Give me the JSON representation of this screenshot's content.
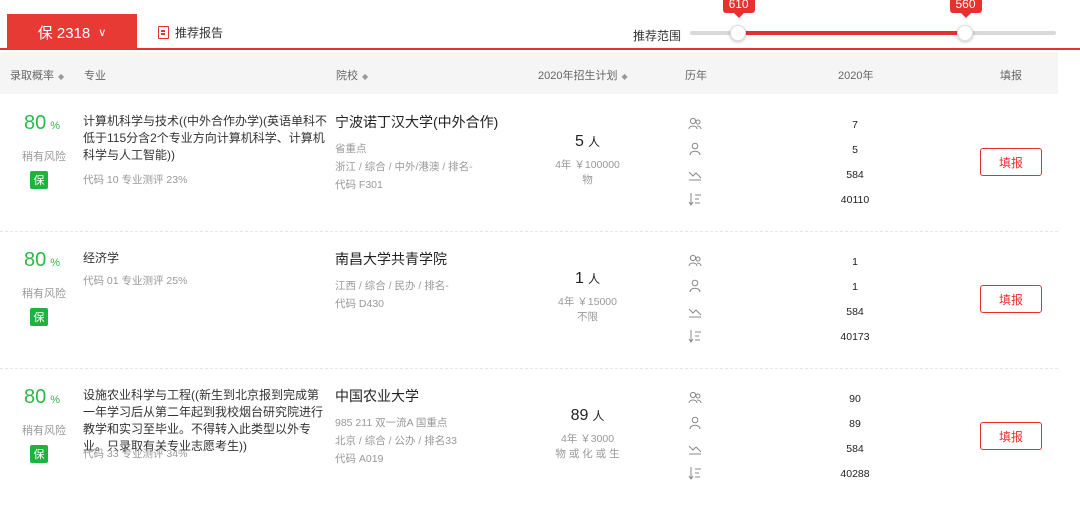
{
  "toolbar": {
    "bao_label": "保 2318",
    "report_label": "推荐报告",
    "range_label": "推荐范围",
    "range_low": "610",
    "range_high": "560",
    "range_low_fraction": 0.13,
    "range_high_fraction": 0.75
  },
  "header": {
    "prob": "录取概率",
    "major": "专业",
    "school": "院校",
    "plan": "2020年招生计划",
    "history": "历年",
    "year": "2020年",
    "fill": "填报"
  },
  "colors": {
    "accent": "#e8302f",
    "safe": "#2db84a"
  },
  "rows": [
    {
      "pct": "80",
      "pct_sym": "%",
      "risk": "稍有风险",
      "badge": "保",
      "major": "计算机科学与技术((中外合作办学)(英语单科不低于115分含2个专业方向计算机科学、计算机科学与人工智能))",
      "major_code": "代码 10   专业测评 23%",
      "school": "宁波诺丁汉大学(中外合作)",
      "school_tags": "省重点",
      "school_info": "浙江 / 综合 / 中外/港澳 / 排名-",
      "school_code": "代码 F301",
      "plan_num": "5",
      "plan_unit": "人",
      "plan_fee": "4年  ￥100000",
      "plan_note": "物",
      "hist": [
        "7",
        "5",
        "584",
        "40110"
      ],
      "fill_label": "填报"
    },
    {
      "pct": "80",
      "pct_sym": "%",
      "risk": "稍有风险",
      "badge": "保",
      "major": "经济学",
      "major_code": "代码 01   专业测评 25%",
      "school": "南昌大学共青学院",
      "school_tags": "",
      "school_info": "江西 / 综合 / 民办 / 排名-",
      "school_code": "代码 D430",
      "plan_num": "1",
      "plan_unit": "人",
      "plan_fee": "4年  ￥15000",
      "plan_note": "不限",
      "hist": [
        "1",
        "1",
        "584",
        "40173"
      ],
      "fill_label": "填报"
    },
    {
      "pct": "80",
      "pct_sym": "%",
      "risk": "稍有风险",
      "badge": "保",
      "major": "设施农业科学与工程((新生到北京报到完成第一年学习后从第二年起到我校烟台研究院进行教学和实习至毕业。不得转入此类型以外专业。只录取有关专业志愿考生))",
      "major_code": "代码 33   专业测评 34%",
      "school": "中国农业大学",
      "school_tags": "985 211 双一流A 国重点",
      "school_info": "北京 / 综合 / 公办 / 排名33",
      "school_code": "代码 A019",
      "plan_num": "89",
      "plan_unit": "人",
      "plan_fee": "4年  ￥3000",
      "plan_note": "物 或 化 或 生",
      "hist": [
        "90",
        "89",
        "584",
        "40288"
      ],
      "fill_label": "填报"
    }
  ]
}
